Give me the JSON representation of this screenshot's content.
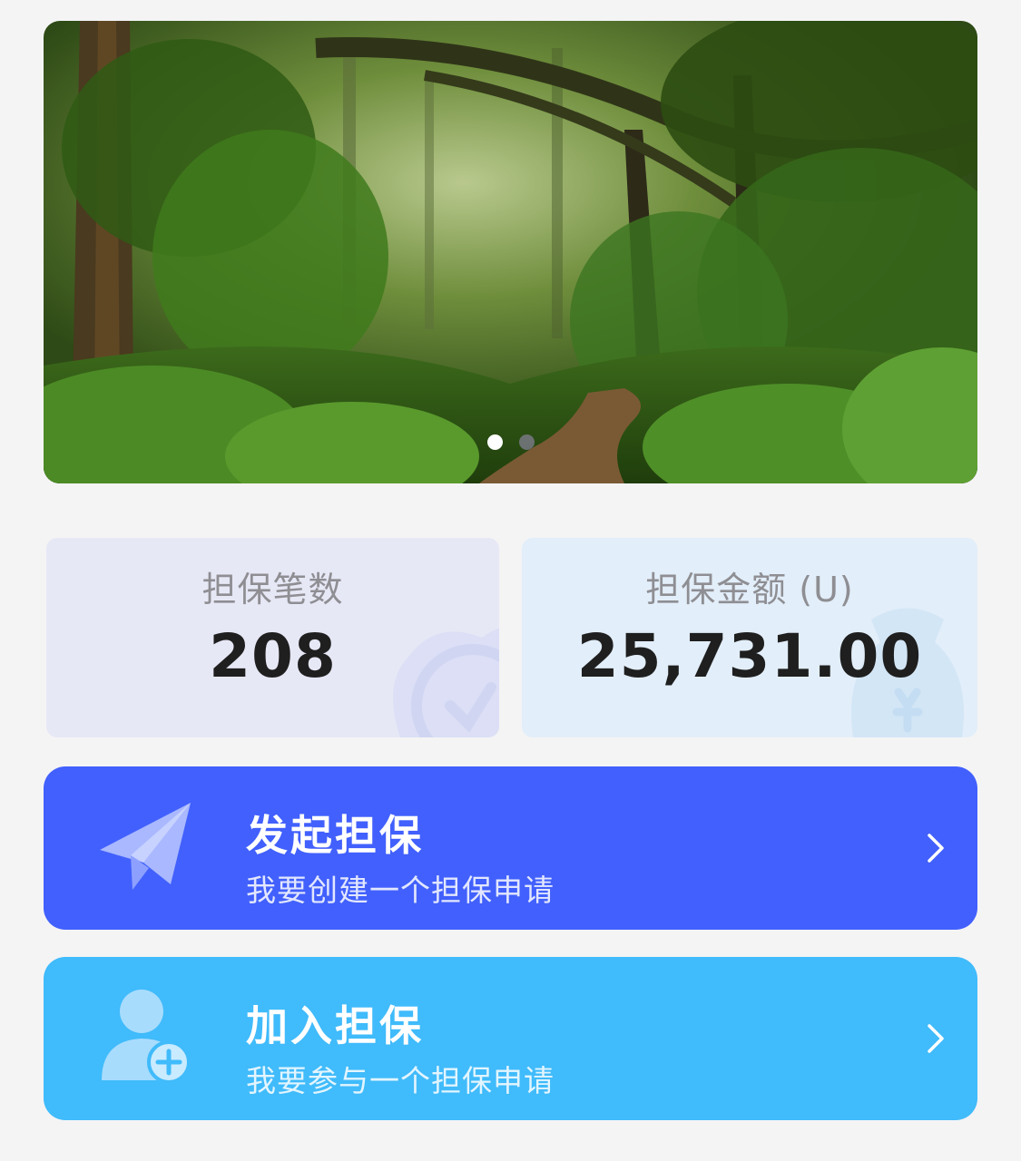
{
  "banner": {
    "image_description": "forest-path-photo",
    "slides": 2,
    "active_slide": 1
  },
  "stats": {
    "count": {
      "label": "担保笔数",
      "value": "208"
    },
    "amount": {
      "label": "担保金额 (U)",
      "value": "25,731.00"
    }
  },
  "actions": {
    "start": {
      "title": "发起担保",
      "subtitle": "我要创建一个担保申请",
      "icon": "paper-plane-icon",
      "color": "#4160fd"
    },
    "join": {
      "title": "加入担保",
      "subtitle": "我要参与一个担保申请",
      "icon": "user-add-icon",
      "color": "#40bbfb"
    }
  },
  "colors": {
    "background": "#f4f4f5",
    "count_card": "#e7e8f6",
    "amount_card": "#e2eef9"
  }
}
